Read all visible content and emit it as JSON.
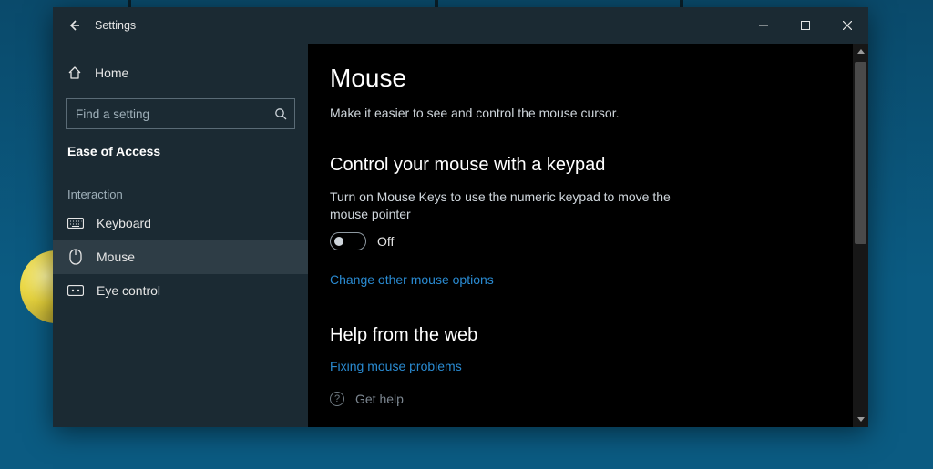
{
  "window": {
    "title": "Settings"
  },
  "sidebar": {
    "home_label": "Home",
    "search_placeholder": "Find a setting",
    "category_label": "Ease of Access",
    "section_label": "Interaction",
    "items": [
      {
        "label": "Keyboard"
      },
      {
        "label": "Mouse"
      },
      {
        "label": "Eye control"
      }
    ]
  },
  "main": {
    "title": "Mouse",
    "description": "Make it easier to see and control the mouse cursor.",
    "keypad": {
      "heading": "Control your mouse with a keypad",
      "body": "Turn on Mouse Keys to use the numeric keypad to move the mouse pointer",
      "toggle_state": "Off",
      "link": "Change other mouse options"
    },
    "help": {
      "heading": "Help from the web",
      "link": "Fixing mouse problems",
      "get_help_label": "Get help"
    }
  }
}
